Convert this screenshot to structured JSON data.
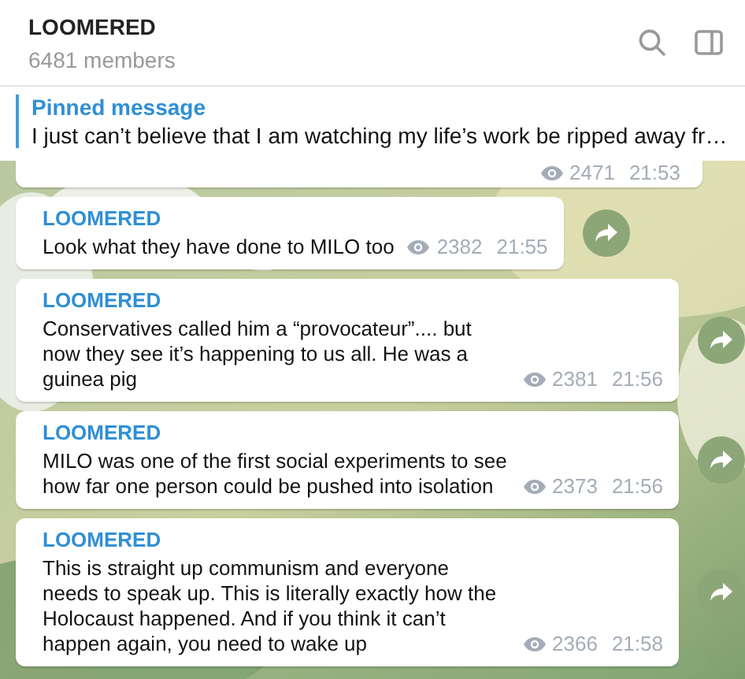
{
  "header": {
    "title": "LOOMERED",
    "subtitle": "6481 members"
  },
  "pinned": {
    "label": "Pinned message",
    "text": "I just can’t believe that I am watching my life’s work be ripped away fr…"
  },
  "messages": [
    {
      "kind": "partial",
      "views": "2471",
      "time": "21:53"
    },
    {
      "kind": "full",
      "author": "LOOMERED",
      "text": "Look what they have done to MILO too",
      "views": "2382",
      "time": "21:55"
    },
    {
      "kind": "full",
      "author": "LOOMERED",
      "text": "Conservatives called him a “provocateur”.... but now they see it’s happening to us all. He was a guinea pig",
      "views": "2381",
      "time": "21:56"
    },
    {
      "kind": "full",
      "author": "LOOMERED",
      "text": "MILO was one of the first social experiments to see how far one person could be pushed into isolation",
      "views": "2373",
      "time": "21:56"
    },
    {
      "kind": "full",
      "author": "LOOMERED",
      "text": "This is straight up communism and everyone needs to speak up. This is literally exactly how the Holocaust happened. And if you think it can’t happen again, you need to wake up",
      "views": "2366",
      "time": "21:58"
    }
  ]
}
